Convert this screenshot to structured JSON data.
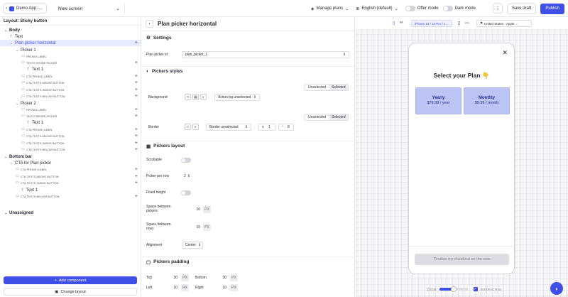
{
  "topbar": {
    "app_name": "Demo App -...",
    "screen_name": "New screen",
    "manage_plans": "Manage plans",
    "language": "English (default)",
    "offer_mode": "Offer mode",
    "dark_mode": "Dark mode",
    "save_draft": "Save draft",
    "publish": "Publish"
  },
  "sidebar": {
    "layout_title": "Layout: Sticky button",
    "tree": [
      {
        "label": "Body",
        "size": "lg",
        "indent": 0,
        "icon": "chev",
        "plus": false,
        "bold": true
      },
      {
        "label": "Text",
        "size": "lg",
        "indent": 1,
        "icon": "text",
        "plus": false
      },
      {
        "label": "Plan picker horizontal",
        "size": "lg",
        "indent": 1,
        "icon": "chev",
        "plus": true,
        "selected": true
      },
      {
        "label": "Picker 1",
        "size": "lg",
        "indent": 2,
        "icon": "chev",
        "plus": false
      },
      {
        "label": "PROMO LABEL",
        "size": "sm",
        "indent": 3,
        "icon": "folder",
        "plus": false
      },
      {
        "label": "TEXTS INSIDE PICKER",
        "size": "sm",
        "indent": 3,
        "icon": "folder",
        "plus": true
      },
      {
        "label": "Text 1",
        "size": "lg",
        "indent": 4,
        "icon": "text",
        "plus": false
      },
      {
        "label": "CTA PROMO LABEL",
        "size": "sm",
        "indent": 3,
        "icon": "folder",
        "plus": true
      },
      {
        "label": "CTA TEXTS ABOVE BUTTON",
        "size": "sm",
        "indent": 3,
        "icon": "folder",
        "plus": true
      },
      {
        "label": "CTA TEXTS INSIDE BUTTON",
        "size": "sm",
        "indent": 3,
        "icon": "folder",
        "plus": true
      },
      {
        "label": "CTA TEXTS BELOW BUTTON",
        "size": "sm",
        "indent": 3,
        "icon": "folder",
        "plus": true
      },
      {
        "label": "Picker 2",
        "size": "lg",
        "indent": 2,
        "icon": "chev",
        "plus": false
      },
      {
        "label": "PROMO LABEL",
        "size": "sm",
        "indent": 3,
        "icon": "folder",
        "plus": true
      },
      {
        "label": "TEXTS INSIDE PICKER",
        "size": "sm",
        "indent": 3,
        "icon": "folder",
        "plus": true
      },
      {
        "label": "Text 1",
        "size": "lg",
        "indent": 4,
        "icon": "text",
        "plus": false
      },
      {
        "label": "CTA PROMO LABEL",
        "size": "sm",
        "indent": 3,
        "icon": "folder",
        "plus": true
      },
      {
        "label": "CTA TEXTS ABOVE BUTTON",
        "size": "sm",
        "indent": 3,
        "icon": "folder",
        "plus": true
      },
      {
        "label": "CTA TEXTS INSIDE BUTTON",
        "size": "sm",
        "indent": 3,
        "icon": "folder",
        "plus": true
      },
      {
        "label": "CTA TEXTS BELOW BUTTON",
        "size": "sm",
        "indent": 3,
        "icon": "folder",
        "plus": true
      },
      {
        "label": "Bottom bar",
        "size": "lg",
        "indent": 0,
        "icon": "chev",
        "plus": false,
        "bold": true
      },
      {
        "label": "CTA for Plan picker",
        "size": "lg",
        "indent": 1,
        "icon": "chev",
        "plus": false
      },
      {
        "label": "CTA PROMO LABEL",
        "size": "sm",
        "indent": 2,
        "icon": "folder",
        "plus": true
      },
      {
        "label": "CTA TEXTS ABOVE BUTTON",
        "size": "sm",
        "indent": 2,
        "icon": "folder",
        "plus": true
      },
      {
        "label": "CTA TEXTS INSIDE BUTTON",
        "size": "sm",
        "indent": 2,
        "icon": "folder",
        "plus": true
      },
      {
        "label": "Text 1",
        "size": "lg",
        "indent": 3,
        "icon": "text",
        "plus": false
      },
      {
        "label": "CTA TEXTS BELOW BUTTON",
        "size": "sm",
        "indent": 2,
        "icon": "folder",
        "plus": true
      },
      {
        "label": "Unassigned",
        "size": "lg",
        "indent": 0,
        "icon": "chev",
        "plus": false,
        "bold": true
      }
    ],
    "add_component": "Add component",
    "change_layout": "Change layout"
  },
  "panel": {
    "title": "Plan picker horizontal",
    "settings_title": "Settings",
    "plan_picker_id_label": "Plan picker id",
    "plan_picker_id_value": "plan_picker_1",
    "styles_title": "Pickers styles",
    "unselected": "Unselected",
    "selected": "Selected",
    "background_label": "Background",
    "background_value": "Action bg unselected",
    "border_label": "Border",
    "border_value": "Border unselected",
    "border_width": "1",
    "border_radius": "8",
    "layout_title": "Pickers layout",
    "scrollable_label": "Scrollable",
    "per_row_label": "Picker per row",
    "per_row_value": "2",
    "fixed_height_label": "Fixed height",
    "space_pickers_label_1": "Space between",
    "space_pickers_label_2": "pickers",
    "space_pickers_value": "10",
    "space_rows_label_1": "Space between",
    "space_rows_label_2": "rows",
    "space_rows_value": "15",
    "px": "PX",
    "alignment_label": "Alignment",
    "alignment_value": "Center",
    "padding_title": "Pickers padding",
    "top_label": "Top",
    "top_value": "30",
    "bottom_label": "Bottom",
    "bottom_value": "30",
    "left_label": "Left",
    "left_value": "10",
    "right_label": "Right",
    "right_value": "10"
  },
  "canvas": {
    "device": "iPhone 13 / 13 Pro / 1...",
    "country": "United States - Apple ...",
    "phone_title": "Select your Plan 👇",
    "plans": [
      {
        "name": "Yearly",
        "price": "$79.99 / year"
      },
      {
        "name": "Monthly",
        "price": "$9.99 / month"
      }
    ],
    "cta": "Finalize my checkout on the web",
    "zoom_label": "ZOOM",
    "interactive_label": "INTERACTIVE",
    "zoom_level": 0.5
  },
  "colors": {
    "accent": "#3f4fe8",
    "plan_fill": "#bcc3f5",
    "selected_row": "#e8eaff"
  }
}
